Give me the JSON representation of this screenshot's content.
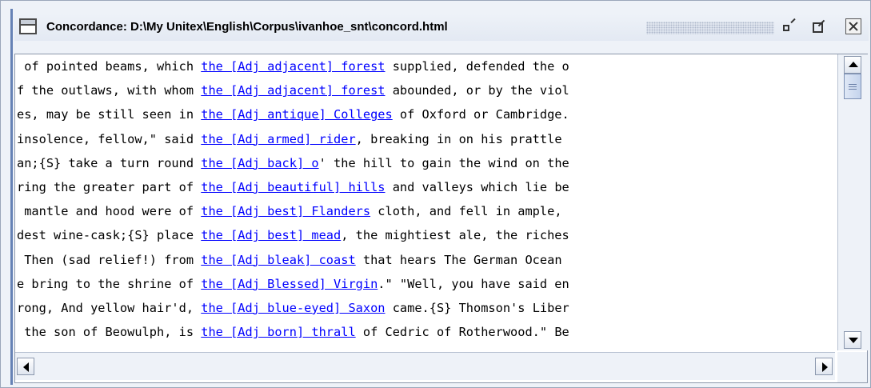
{
  "window": {
    "title": "Concordance: D:\\My Unitex\\English\\Corpus\\ivanhoe_snt\\concord.html",
    "controls": [
      "minimize-icon",
      "maximize-icon",
      "close-icon"
    ],
    "accent_color": "#6682b5"
  },
  "concordance": {
    "link_color": "#0000ff",
    "lines": [
      {
        "left": " of pointed beams, which ",
        "match": "the [Adj adjacent] forest",
        "right": " supplied, defended the o"
      },
      {
        "left": "f the outlaws, with whom ",
        "match": "the [Adj adjacent] forest",
        "right": " abounded, or by the viol"
      },
      {
        "left": "es, may be still seen in ",
        "match": "the [Adj antique] Colleges",
        "right": " of Oxford or Cambridge."
      },
      {
        "left": "insolence, fellow,\" said ",
        "match": "the [Adj armed] rider",
        "right": ", breaking in on his prattle"
      },
      {
        "left": "an;{S} take a turn round ",
        "match": "the [Adj back] o",
        "right": "' the hill to gain the wind on the"
      },
      {
        "left": "ring the greater part of ",
        "match": "the [Adj beautiful] hills",
        "right": " and valleys which lie be"
      },
      {
        "left": " mantle and hood were of ",
        "match": "the [Adj best] Flanders",
        "right": " cloth, and fell in ample,"
      },
      {
        "left": "dest wine-cask;{S} place ",
        "match": "the [Adj best] mead",
        "right": ", the mightiest ale, the riches"
      },
      {
        "left": " Then (sad relief!) from ",
        "match": "the [Adj bleak] coast",
        "right": " that hears The German Ocean"
      },
      {
        "left": "e bring to the shrine of ",
        "match": "the [Adj Blessed] Virgin",
        "right": ".\" \"Well, you have said en"
      },
      {
        "left": "rong, And yellow hair'd, ",
        "match": "the [Adj blue-eyed] Saxon",
        "right": " came.{S} Thomson's Liber"
      },
      {
        "left": " the son of Beowulph, is ",
        "match": "the [Adj born] thrall",
        "right": " of Cedric of Rotherwood.\" Be"
      }
    ]
  },
  "scrollbars": {
    "vertical": {
      "up": "up-arrow-icon",
      "down": "down-arrow-icon",
      "position": 0.0
    },
    "horizontal": {
      "left": "left-arrow-icon",
      "right": "right-arrow-icon"
    }
  }
}
